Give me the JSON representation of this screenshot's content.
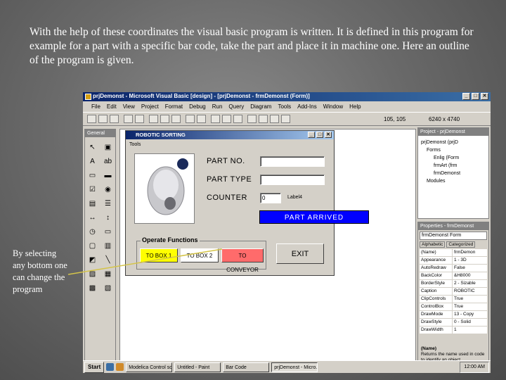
{
  "caption": "With the help of these coordinates the visual basic program is written. It is defined in this program for example for a part with a specific bar code, take the part and place it in machine one. Here an outline of the program is given.",
  "side_note": "By selecting any bottom one can change the program",
  "app": {
    "title": "prjDemonst - Microsoft Visual Basic [design] - [prjDemonst - frmDemonst (Form)]",
    "menu": [
      "File",
      "Edit",
      "View",
      "Project",
      "Format",
      "Debug",
      "Run",
      "Query",
      "Diagram",
      "Tools",
      "Add-Ins",
      "Window",
      "Help"
    ],
    "toolbar_coords": "105, 105",
    "toolbar_size": "6240 x 4740"
  },
  "toolbox": {
    "title": "General"
  },
  "form": {
    "title": "ROBOTIC SORTING",
    "tab_label": "Tools",
    "part_no_label": "PART NO.",
    "part_type_label": "PART TYPE",
    "counter_label": "COUNTER",
    "counter_value": "0",
    "label4": "Label4",
    "part_arrived": "PART ARRIVED",
    "operate_title": "Operate Functions",
    "buttons": [
      {
        "label": "TO BOX 1",
        "color": "#ffff00"
      },
      {
        "label": "TO BOX 2",
        "color": "#ffffff"
      },
      {
        "label": "TO CONVEYOR",
        "color": "#ff6b6b"
      }
    ],
    "exit_label": "EXIT"
  },
  "project": {
    "title": "Project - prjDemonst",
    "items": [
      "prjDemonst (prjD",
      "Forms",
      "Enlig (Form",
      "frmArt (frm",
      "frmDemonst",
      "Modules"
    ]
  },
  "properties": {
    "title": "Properties - frmDemonst",
    "object": "frmDemonst Form",
    "tabs": [
      "Alphabetic",
      "Categorized"
    ],
    "rows": [
      [
        "(Name)",
        "frmDemon"
      ],
      [
        "Appearance",
        "1 - 3D"
      ],
      [
        "AutoRedraw",
        "False"
      ],
      [
        "BackColor",
        "&H8000"
      ],
      [
        "BorderStyle",
        "2 - Sizable"
      ],
      [
        "Caption",
        "ROBOTIC"
      ],
      [
        "ClipControls",
        "True"
      ],
      [
        "ControlBox",
        "True"
      ],
      [
        "DrawMode",
        "13 - Copy"
      ],
      [
        "DrawStyle",
        "0 - Solid"
      ],
      [
        "DrawWidth",
        "1"
      ]
    ],
    "desc_title": "(Name)",
    "desc_text": "Returns the name used in code to identify an object."
  },
  "taskbar": {
    "start": "Start",
    "tasks": [
      "Modelica Control so...",
      "Untitled - Paint",
      "Bar Code",
      "prjDemonst - Micro..."
    ],
    "active_index": 3,
    "clock": "12:00 AM"
  }
}
